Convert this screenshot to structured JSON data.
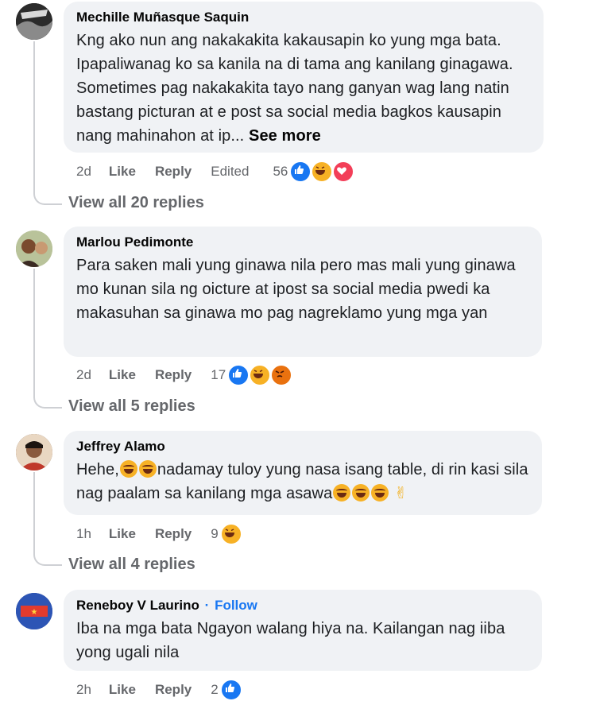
{
  "comments": [
    {
      "author": "Mechille Muñasque Saquin",
      "text": "Kng ako nun ang nakakakita kakausapin ko yung mga bata. Ipapaliwanag ko sa kanila na di tama ang kanilang ginagawa. Sometimes pag nakakakita tayo nang ganyan wag lang natin bastang picturan at e post sa social media bagkos kausapin nang mahinahon at ip...",
      "see_more": "See more",
      "time": "2d",
      "like": "Like",
      "reply": "Reply",
      "edited": "Edited",
      "reaction_count": "56",
      "reactions": [
        "like-reaction-icon",
        "haha-reaction-icon",
        "love-reaction-icon"
      ],
      "view_replies": "View all 20 replies"
    },
    {
      "author": "Marlou Pedimonte",
      "text": "Para saken mali yung ginawa nila pero mas mali yung ginawa mo kunan sila ng oicture at ipost sa social media pwedi ka makasuhan sa ginawa mo pag nagreklamo yung mga yan",
      "time": "2d",
      "like": "Like",
      "reply": "Reply",
      "reaction_count": "17",
      "reactions": [
        "like-reaction-icon",
        "haha-reaction-icon",
        "angry-reaction-icon"
      ],
      "view_replies": "View all 5 replies"
    },
    {
      "author": "Jeffrey Alamo",
      "text_part1": "Hehe,",
      "text_part2": "nadamay tuloy yung nasa isang table, di rin kasi sila nag paalam sa kanilang mga asawa",
      "time": "1h",
      "like": "Like",
      "reply": "Reply",
      "reaction_count": "9",
      "reactions": [
        "haha-reaction-icon"
      ],
      "view_replies": "View all 4 replies"
    },
    {
      "author": "Reneboy V Laurino",
      "separator": "·",
      "follow": "Follow",
      "text": "Iba na mga bata Ngayon walang hiya na. Kailangan nag iiba yong ugali nila",
      "time": "2h",
      "like": "Like",
      "reply": "Reply",
      "reaction_count": "2",
      "reactions": [
        "like-reaction-icon"
      ]
    }
  ],
  "colors": {
    "bubble": "#f0f2f5",
    "secondary_text": "#65676b",
    "link_blue": "#1877f2",
    "like_blue": "#1877f2",
    "love_red": "#f33e58",
    "haha_yellow": "#f7b125",
    "angry_orange": "#e9710f"
  }
}
